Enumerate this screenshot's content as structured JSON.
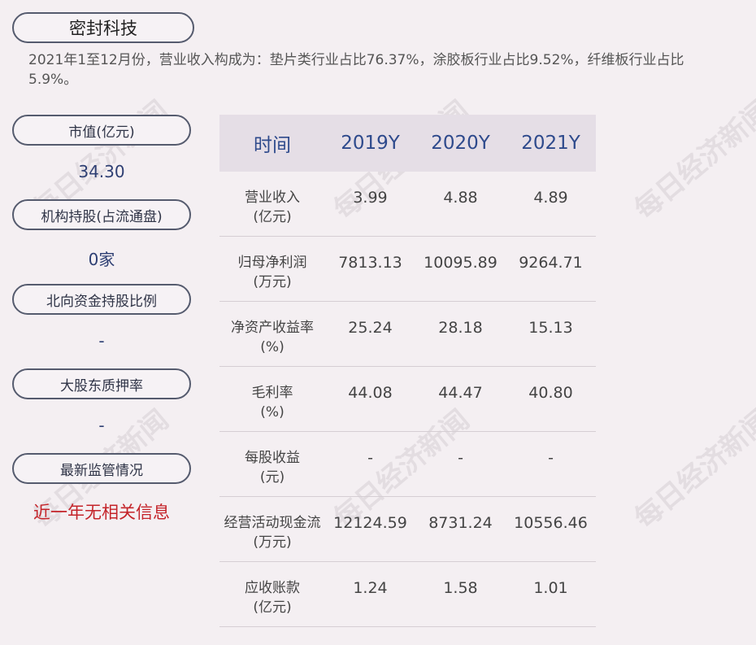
{
  "company": "密封科技",
  "summary": "2021年1至12月份，营业收入构成为：垫片类行业占比76.37%，涂胶板行业占比9.52%，纤维板行业占比5.9%。",
  "side": [
    {
      "label": "市值(亿元)",
      "value": "34.30"
    },
    {
      "label": "机构持股(占流通盘)",
      "value": "0家"
    },
    {
      "label": "北向资金持股比例",
      "value": "-"
    },
    {
      "label": "大股东质押率",
      "value": "-"
    },
    {
      "label": "最新监管情况",
      "value": "近一年无相关信息"
    }
  ],
  "table": {
    "headers": [
      "时间",
      "2019Y",
      "2020Y",
      "2021Y"
    ],
    "rows": [
      {
        "label1": "营业收入",
        "label2": "(亿元)",
        "values": [
          "3.99",
          "4.88",
          "4.89"
        ]
      },
      {
        "label1": "归母净利润",
        "label2": "(万元)",
        "values": [
          "7813.13",
          "10095.89",
          "9264.71"
        ]
      },
      {
        "label1": "净资产收益率",
        "label2": "(%)",
        "values": [
          "25.24",
          "28.18",
          "15.13"
        ]
      },
      {
        "label1": "毛利率",
        "label2": "(%)",
        "values": [
          "44.08",
          "44.47",
          "40.80"
        ]
      },
      {
        "label1": "每股收益",
        "label2": "(元)",
        "values": [
          "-",
          "-",
          "-"
        ]
      },
      {
        "label1": "经营活动现金流",
        "label2": "(万元)",
        "values": [
          "12124.59",
          "8731.24",
          "10556.46"
        ]
      },
      {
        "label1": "应收账款",
        "label2": "(亿元)",
        "values": [
          "1.24",
          "1.58",
          "1.01"
        ]
      }
    ]
  },
  "watermark": "每日经济新闻",
  "colors": {
    "background": "#f4eff2",
    "header_bg": "#e5dee6",
    "accent_blue": "#2e4a8c",
    "alert_red": "#c4242a"
  }
}
